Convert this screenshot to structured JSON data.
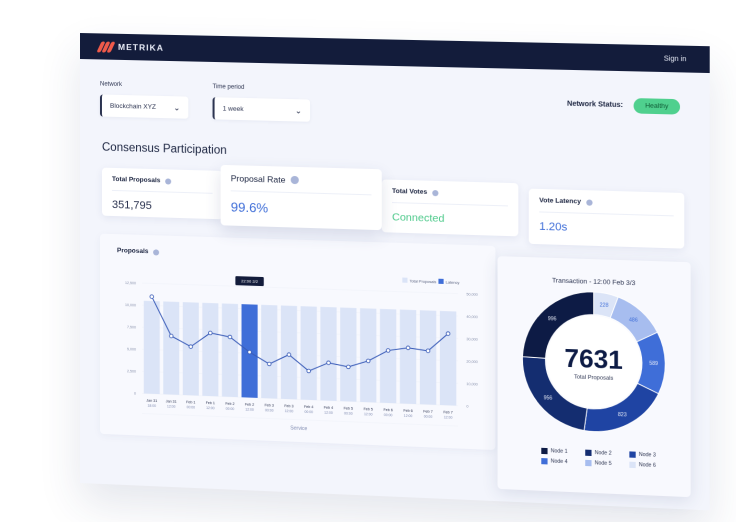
{
  "header": {
    "brand": "METRIKA",
    "signin_label": "Sign in"
  },
  "filters": {
    "network": {
      "label": "Network",
      "value": "Blockchain XYZ"
    },
    "period": {
      "label": "Time period",
      "value": "1 week"
    }
  },
  "network_status": {
    "label": "Network Status:",
    "value": "Healthy",
    "color": "#4fd08e"
  },
  "section_title": "Consensus Participation",
  "kpis": {
    "total_proposals": {
      "label": "Total Proposals",
      "value": "351,795"
    },
    "proposal_rate": {
      "label": "Proposal Rate",
      "value": "99.6%"
    },
    "total_votes": {
      "label": "Total Votes",
      "value": "Connected"
    },
    "vote_latency": {
      "label": "Vote Latency",
      "value": "1.20s"
    }
  },
  "proposals_chart": {
    "title": "Proposals",
    "tooltip": "22:00 2/2"
  },
  "donut_card": {
    "title": "Transaction - 12:00 Feb 3/3",
    "total": "7631",
    "total_label": "Total Proposals"
  },
  "chart_data": [
    {
      "type": "bar",
      "title": "Proposals",
      "xlabel": "Service",
      "ylabel": "",
      "categories": [
        "Jan 31 18:00",
        "Jan 31 12:00",
        "Feb 1 00:00",
        "Feb 1 12:00",
        "Feb 2 00:00",
        "Feb 2 12:00",
        "Feb 3 00:00",
        "Feb 3 12:00",
        "Feb 4 00:00",
        "Feb 4 12:00",
        "Feb 5 00:00",
        "Feb 5 12:00",
        "Feb 6 00:00",
        "Feb 6 12:00",
        "Feb 7 00:00",
        "Feb 7 12:00"
      ],
      "x_tick_top": [
        "Jan 31",
        "Jan 31",
        "Feb 1",
        "Feb 1",
        "Feb 2",
        "Feb 2",
        "Feb 3",
        "Feb 3",
        "Feb 4",
        "Feb 4",
        "Feb 5",
        "Feb 5",
        "Feb 6",
        "Feb 6",
        "Feb 7",
        "Feb 7"
      ],
      "x_tick_bottom": [
        "18:00",
        "12:00",
        "00:00",
        "12:00",
        "00:00",
        "12:00",
        "00:00",
        "12:00",
        "00:00",
        "12:00",
        "00:00",
        "12:00",
        "00:00",
        "12:00",
        "00:00",
        "12:00"
      ],
      "highlight_index": 5,
      "series": [
        {
          "name": "Total Proposals",
          "axis": "left",
          "type": "bar",
          "color": "#dbe4f7",
          "highlight_color": "#3f6ed8",
          "values": [
            10500,
            10500,
            10500,
            10500,
            10500,
            10500,
            10500,
            10500,
            10500,
            10500,
            10500,
            10500,
            10500,
            10500,
            10500,
            10500
          ]
        },
        {
          "name": "Latency",
          "axis": "right",
          "type": "line",
          "color": "#3a5cb8",
          "values": [
            44000,
            26500,
            22000,
            28500,
            27000,
            20500,
            15500,
            20000,
            13000,
            17000,
            15500,
            18500,
            23500,
            25000,
            24000,
            32000
          ]
        }
      ],
      "y_left": {
        "ticks": [
          "12,500",
          "10,000",
          "7,500",
          "5,000",
          "2,500",
          "0"
        ],
        "range": [
          0,
          12500
        ]
      },
      "y_right": {
        "ticks": [
          "50,000",
          "40,000",
          "30,000",
          "20,000",
          "10,000",
          "0"
        ],
        "range": [
          0,
          50000
        ]
      },
      "legend": [
        "Total Proposals",
        "Latency"
      ],
      "legend_position": "top-right",
      "grid": true
    },
    {
      "type": "pie",
      "title": "Transaction - 12:00 Feb 3/3",
      "center_value": 7631,
      "center_label": "Total Proposals",
      "slices": [
        {
          "label": "Node 6",
          "value": 228,
          "color": "#dbe4f7"
        },
        {
          "label": "Node 5",
          "value": 486,
          "color": "#a7bdef"
        },
        {
          "label": "Node 4",
          "value": 589,
          "color": "#3f6ed8"
        },
        {
          "label": "Node 3",
          "value": 823,
          "color": "#1f44a3"
        },
        {
          "label": "Node 2",
          "value": 956,
          "color": "#142d70"
        },
        {
          "label": "Node 1",
          "value": 996,
          "color": "#0d1b45"
        }
      ],
      "legend": [
        "Node 1",
        "Node 2",
        "Node 3",
        "Node 4",
        "Node 5",
        "Node 6"
      ],
      "legend_position": "bottom"
    }
  ]
}
